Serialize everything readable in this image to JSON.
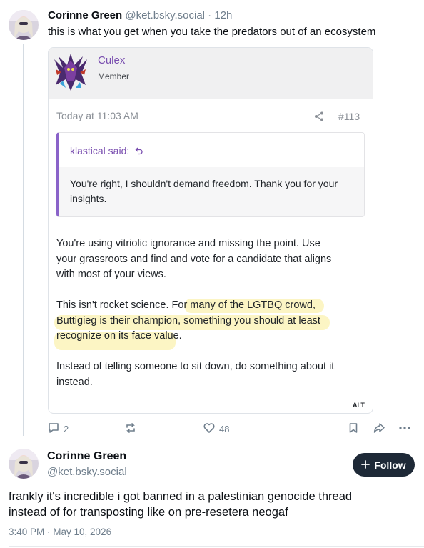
{
  "post1": {
    "display_name": "Corinne Green",
    "handle": "@ket.bsky.social",
    "time": " · 12h",
    "text": "this is what you get when you take the predators out of an ecosystem",
    "embed": {
      "username": "Culex",
      "role": "Member",
      "timestamp": "Today at 11:03 AM",
      "post_number": "#113",
      "quote_author": "klastical said:",
      "quote_text_1": "You're right, I shouldn't demand freedom. Thank you for your",
      "quote_text_2": "insights.",
      "para1_l1": "You're using vitriolic ignorance and missing the point. Use",
      "para1_l2": "your grassroots and find and vote for a candidate that aligns",
      "para1_l3": "with most of your views.",
      "para2_l1": "This isn't rocket science. For many of the LGTBQ crowd,",
      "para2_l2": "Buttigieg is their champion, something you should at least",
      "para2_l3": "recognize on its face value.",
      "para3_l1": "Instead of telling someone to sit down, do something about it",
      "para3_l2": "instead.",
      "alt_badge": "ALT"
    },
    "actions": {
      "reply_count": "2",
      "like_count": "48"
    }
  },
  "post2": {
    "display_name": "Corinne Green",
    "handle": "@ket.bsky.social",
    "follow_label": "Follow",
    "text_l1": "frankly it's incredible i got banned in a palestinian genocide thread",
    "text_l2": "instead of for transposting like on pre-resetera neogaf",
    "timestamp": "3:40 PM · May 10, 2026"
  },
  "icons": [
    "avatar",
    "reply-icon",
    "repost-icon",
    "like-icon",
    "bookmark-icon",
    "share-icon",
    "more-icon",
    "share-small-icon",
    "quote-arrow-icon",
    "plus-icon"
  ],
  "colors": {
    "accent_purple": "#7a4fb0",
    "follow_bg": "#1e2937",
    "muted": "#6f7e8c",
    "highlight": "#fbf1b0"
  }
}
